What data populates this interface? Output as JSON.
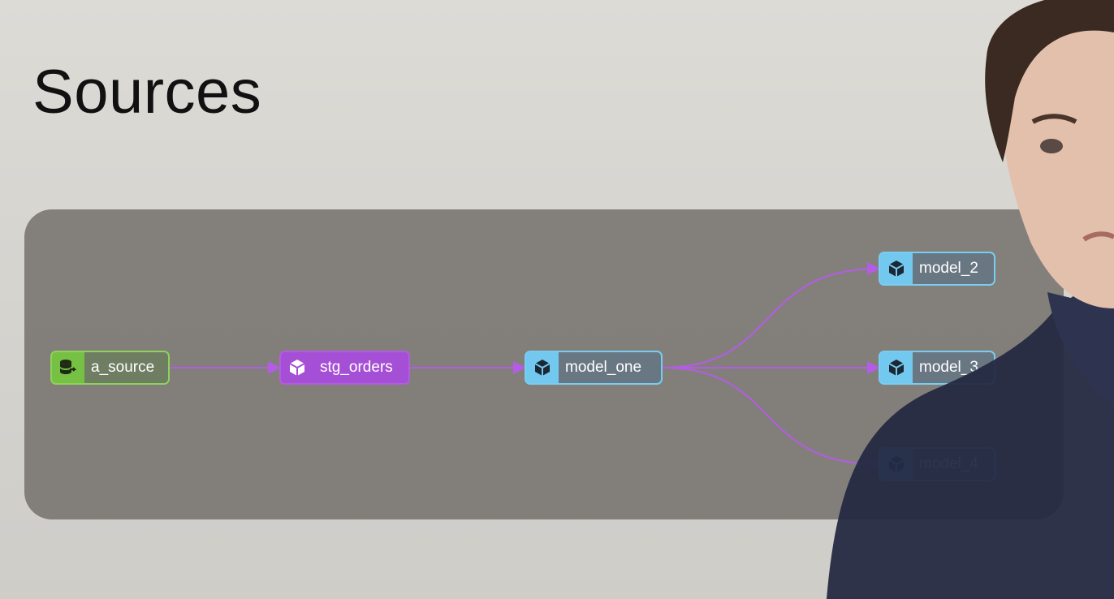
{
  "title": "Sources",
  "colors": {
    "source": "#7fc84b",
    "staging": "#a54fd6",
    "model": "#72c8ee",
    "edge": "#b45ce6"
  },
  "nodes": [
    {
      "id": "a_source",
      "label": "a_source",
      "kind": "source",
      "icon": "database-arrow-icon"
    },
    {
      "id": "stg_orders",
      "label": "stg_orders",
      "kind": "staging",
      "icon": "cube-icon"
    },
    {
      "id": "model_one",
      "label": "model_one",
      "kind": "model",
      "icon": "cube-icon"
    },
    {
      "id": "model_2",
      "label": "model_2",
      "kind": "model",
      "icon": "cube-icon"
    },
    {
      "id": "model_3",
      "label": "model_3",
      "kind": "model",
      "icon": "cube-icon"
    },
    {
      "id": "model_4",
      "label": "model_4",
      "kind": "model",
      "icon": "cube-icon"
    }
  ],
  "edges": [
    {
      "from": "a_source",
      "to": "stg_orders"
    },
    {
      "from": "stg_orders",
      "to": "model_one"
    },
    {
      "from": "model_one",
      "to": "model_2"
    },
    {
      "from": "model_one",
      "to": "model_3"
    },
    {
      "from": "model_one",
      "to": "model_4"
    }
  ]
}
